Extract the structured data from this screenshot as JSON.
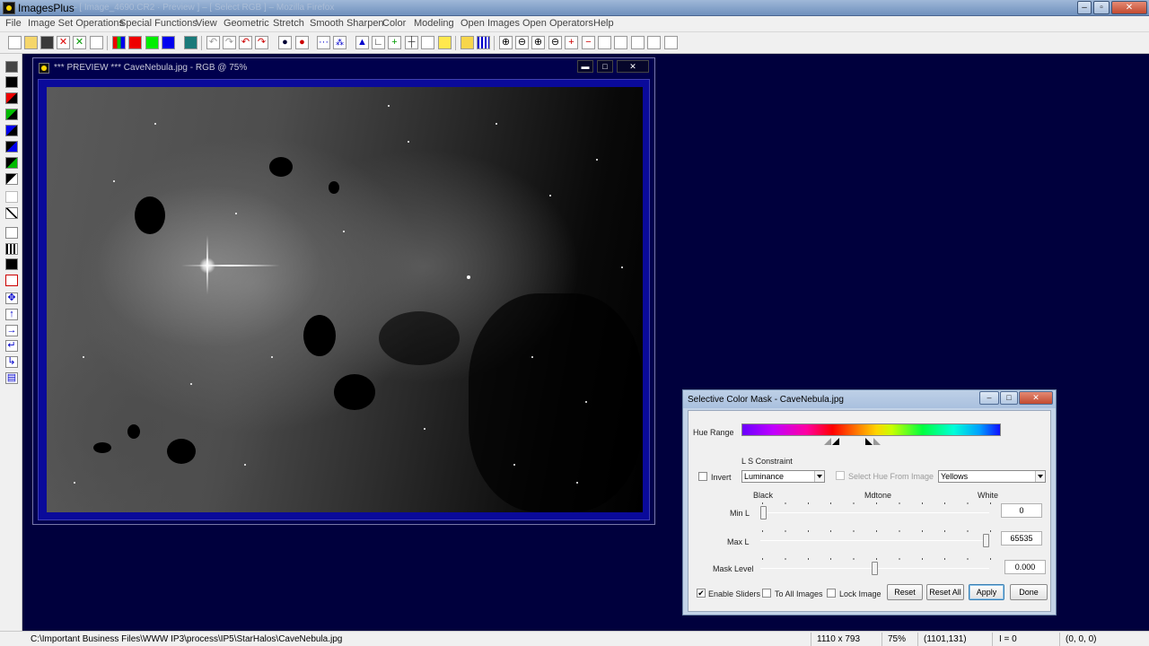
{
  "app": {
    "title": "ImagesPlus",
    "title_ghost": "– [ Image_4690.CR2 · Preview ] – [ Select RGB ] – Mozilla Firefox",
    "window_buttons": {
      "minimize": "–",
      "maximize": "▫",
      "close": "✕"
    }
  },
  "menu": [
    "File",
    "Image Set Operations",
    "Special Functions",
    "View",
    "Geometric",
    "Stretch",
    "Smooth Sharpen",
    "Color",
    "Modeling",
    "Open Images",
    "Open Operators",
    "Help"
  ],
  "preview": {
    "title": "*** PREVIEW *** CaveNebula.jpg - RGB @ 75%",
    "buttons": {
      "minimize": "▬",
      "maximize": "□",
      "close": "✕"
    }
  },
  "dialog": {
    "title": "Selective Color Mask - CaveNebula.jpg",
    "buttons": {
      "minimize": "–",
      "maximize": "□",
      "close": "✕"
    },
    "hue_range_label": "Hue Range",
    "ls_constraint_label": "L S Constraint",
    "invent_label": "Invert",
    "invert_checked": false,
    "constraint_value": "Luminance",
    "select_hue_label": "Select Hue From Image",
    "select_hue_checked": false,
    "color_value": "Yellows",
    "scale_labels": {
      "black": "Black",
      "midtone": "Mdtone",
      "white": "White"
    },
    "sliders": [
      {
        "label": "Min L",
        "value": "0",
        "fraction": 0.0
      },
      {
        "label": "Max L",
        "value": "65535",
        "fraction": 1.0
      },
      {
        "label": "Mask Level",
        "value": "0.000",
        "fraction": 0.5
      }
    ],
    "enable_sliders_label": "Enable Sliders",
    "enable_sliders_checked": true,
    "to_all_images_label": "To All Images",
    "to_all_images_checked": false,
    "lock_image_label": "Lock Image",
    "lock_image_checked": false,
    "reset_label": "Reset",
    "reset_all_label": "Reset All",
    "apply_label": "Apply",
    "done_label": "Done",
    "check_mark": "✔"
  },
  "status": {
    "path": "C:\\Important Business Files\\WWW IP3\\process\\IP5\\StarHalos\\CaveNebula.jpg",
    "dimensions": "1110 x 793",
    "zoom": "75%",
    "coords": "(1101,131)",
    "intensity": "I = 0",
    "rgb": "(0, 0, 0)"
  },
  "colors": {
    "workspace_bg": "#00003d",
    "preview_frame": "#0a0a9a",
    "hue_bar": [
      "#6a00ff",
      "#ff00a0",
      "#ff0000",
      "#ff8000",
      "#ffd400",
      "#00ff40",
      "#00ffd8",
      "#1010ff"
    ]
  },
  "icons": {
    "toolbar": [
      "new-file-icon",
      "open-folder-icon",
      "save-icon",
      "close-red-x-icon",
      "close-green-x-icon",
      "copy-icon",
      "rgb-channels-icon",
      "red-channel-icon",
      "green-channel-icon",
      "blue-channel-icon",
      "grid-icon",
      "undo-icon",
      "redo-icon",
      "undo-red-icon",
      "redo-red-icon",
      "record-icon",
      "record-red-icon",
      "dots-icon",
      "target-icon",
      "blue-triangle-icon",
      "crop-icon",
      "plus-green-icon",
      "crosshair-icon",
      "box-icon",
      "paint-icon",
      "pencil-icon",
      "grid-small-icon",
      "zoom-in-icon",
      "zoom-out-icon",
      "zoom-fit-icon",
      "zoom-actual-icon",
      "plus-box-icon",
      "minus-box-icon",
      "square-icon",
      "square-icon-2",
      "square-icon-3",
      "square-icon-4",
      "square-icon-5"
    ],
    "left": [
      "save-icon",
      "black-square-icon",
      "red-black-icon",
      "green-black-icon",
      "blue-black-icon",
      "black-blue-icon",
      "black-green-icon",
      "black-white-icon",
      "rotate-icon",
      "brush-icon",
      "target-box-icon",
      "bars-icon",
      "black-bar-icon",
      "red-r-icon",
      "move-icon",
      "up-arrow-icon",
      "right-arrow-icon",
      "return-icon",
      "down-return-icon",
      "stack-icon"
    ]
  }
}
